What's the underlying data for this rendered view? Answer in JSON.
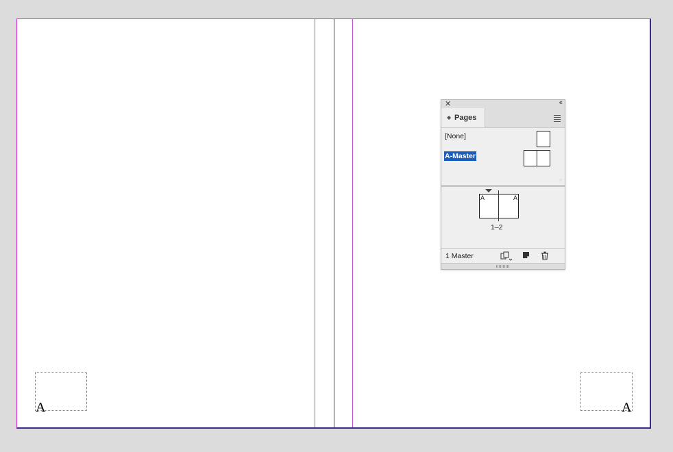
{
  "document": {
    "left_page_letter": "A",
    "right_page_letter": "A"
  },
  "pages_panel": {
    "tab_label": "Pages",
    "masters": [
      {
        "label": "[None]",
        "selected": false
      },
      {
        "label": "A-Master",
        "selected": true
      }
    ],
    "spread": {
      "left_prefix": "A",
      "right_prefix": "A",
      "label": "1–2"
    },
    "status": "1 Master",
    "icons": {
      "close": "close-icon",
      "collapse": "double-chevron-left-icon",
      "menu": "hamburger-menu-icon",
      "edit_page_size": "edit-page-size-icon",
      "new_page": "new-page-icon",
      "delete": "trash-icon"
    }
  },
  "colors": {
    "margin_guide": "#d62bd6",
    "bleed_edge": "#3d2a8a",
    "frame_edge": "#3b86d6",
    "selection": "#1b5dbd"
  }
}
